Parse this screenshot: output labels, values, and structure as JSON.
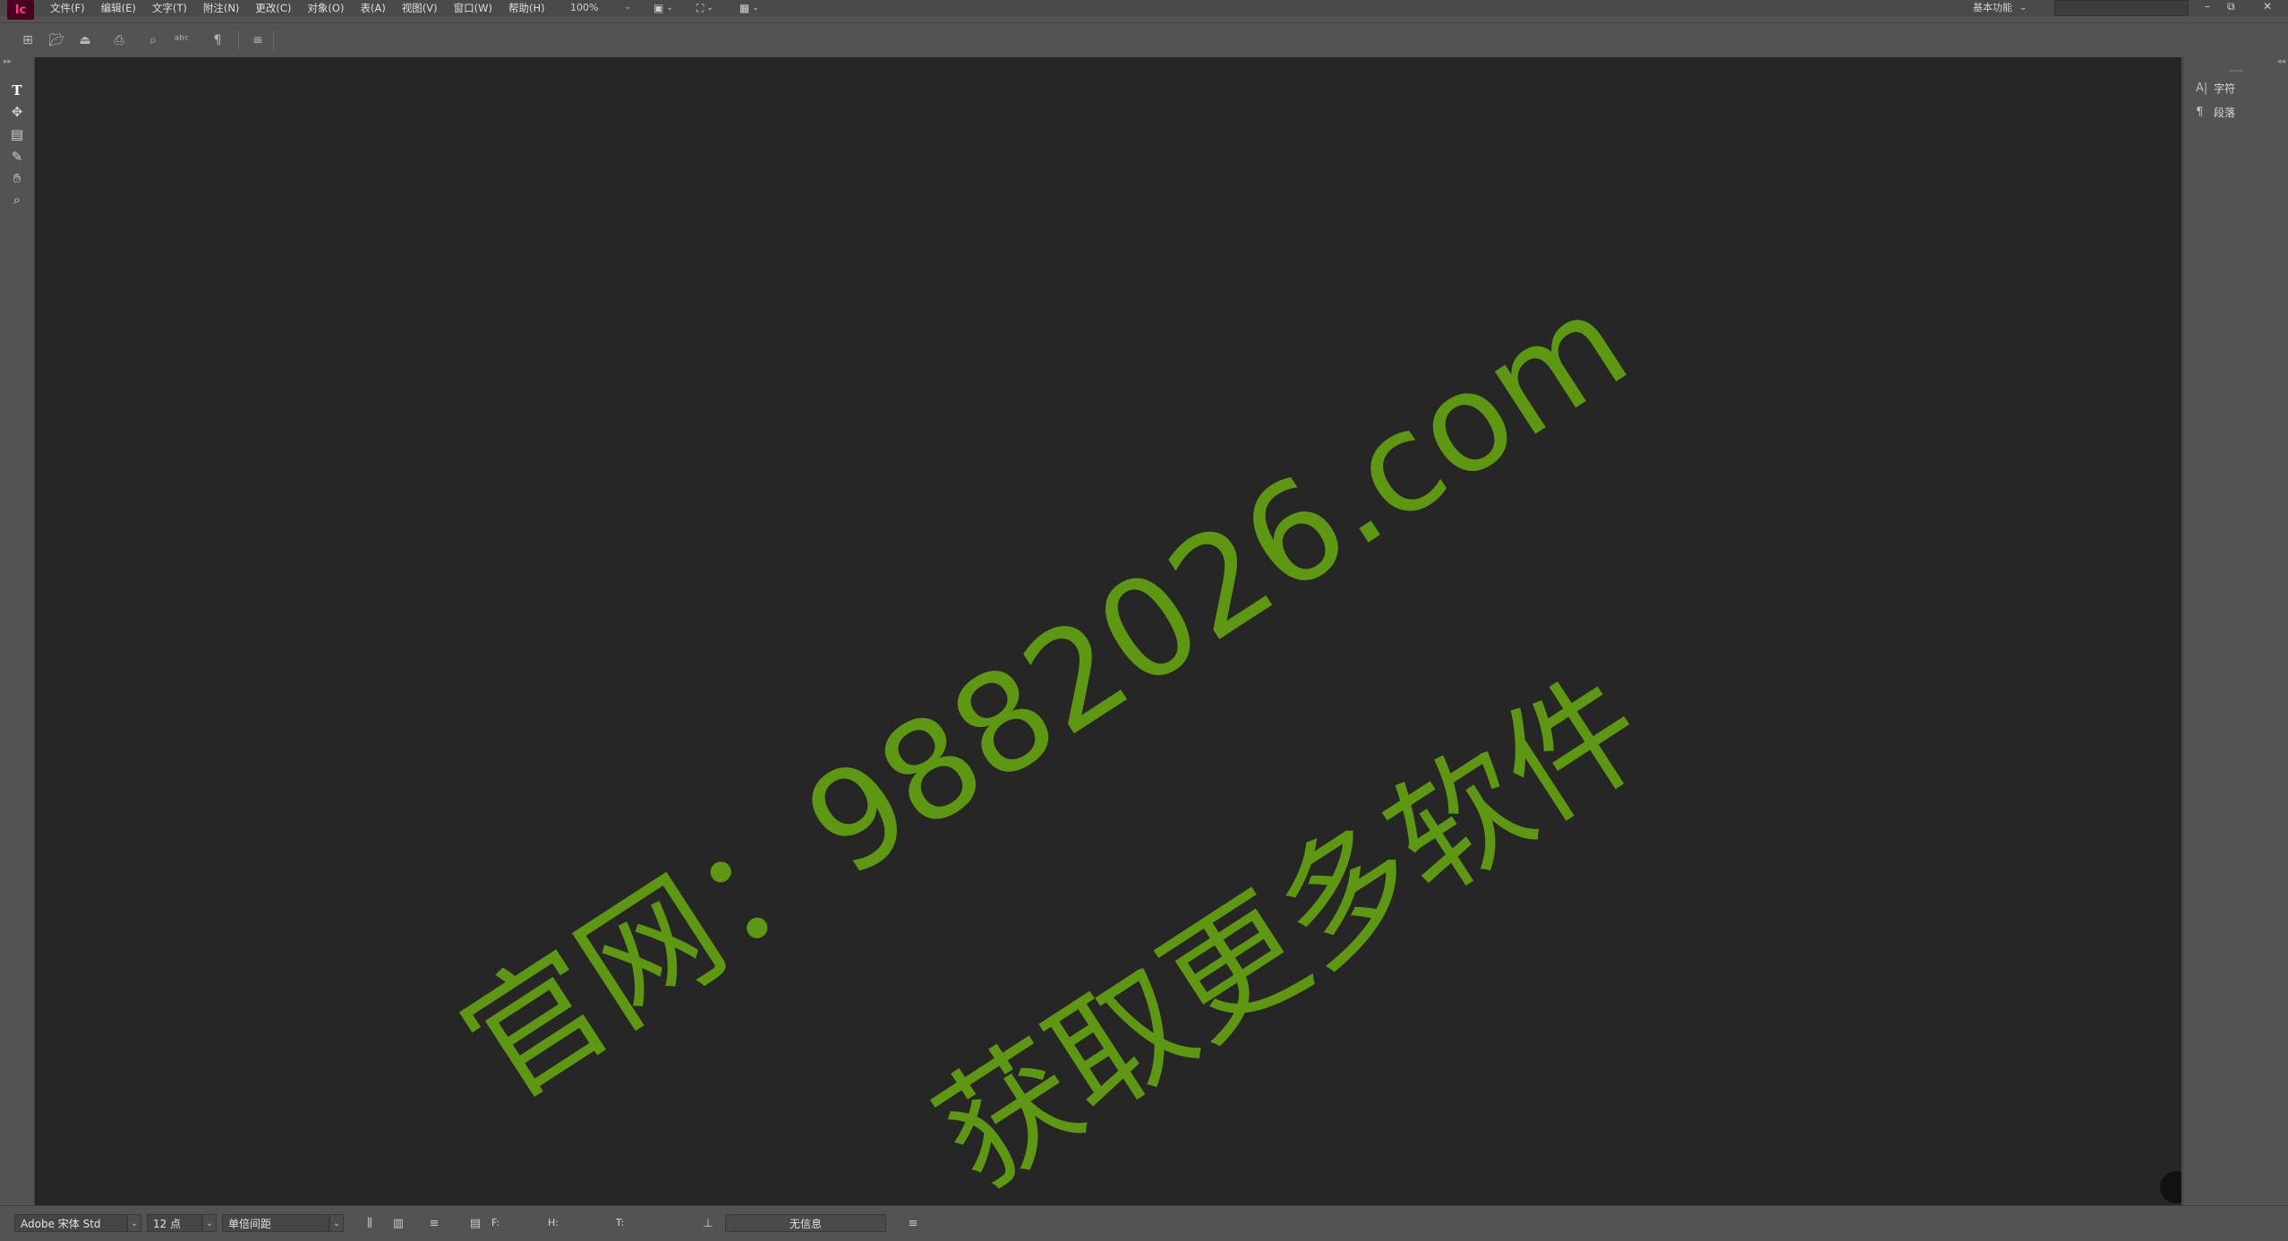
{
  "app": {
    "logo": "Ic"
  },
  "menu": {
    "items": [
      "文件(F)",
      "编辑(E)",
      "文字(T)",
      "附注(N)",
      "更改(C)",
      "对象(O)",
      "表(A)",
      "视图(V)",
      "窗口(W)",
      "帮助(H)"
    ]
  },
  "zoom": {
    "value": "100%"
  },
  "workspace": {
    "label": "基本功能"
  },
  "toolbar": {
    "icons": [
      "new-document-icon",
      "open-folder-icon",
      "save-icon",
      "print-icon",
      "find-icon",
      "spell-check-icon",
      "show-hidden-characters-icon",
      "panel-menu-icon"
    ]
  },
  "tools": [
    "type-tool",
    "position-tool",
    "note-tool",
    "eyedropper-tool",
    "hand-tool",
    "zoom-tool"
  ],
  "watermark": {
    "line1": "官网：9882026.com",
    "line2": "获取更多软件",
    "color": "#5e9712"
  },
  "right_panel": {
    "items": [
      {
        "icon": "A|",
        "label": "字符"
      },
      {
        "icon": "¶",
        "label": "段落"
      }
    ]
  },
  "statusbar": {
    "font_family": "Adobe 宋体 Std",
    "font_size": "12 点",
    "spacing": "单倍间距",
    "field_f": "F:",
    "field_h": "H:",
    "field_t": "T:",
    "info": "无信息"
  }
}
